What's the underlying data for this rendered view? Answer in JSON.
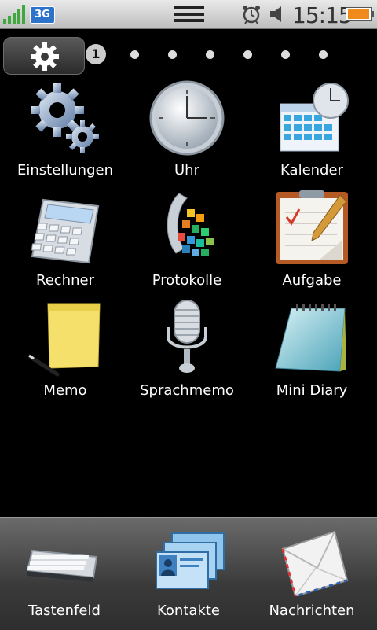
{
  "status_bar": {
    "network_type": "3G",
    "time": "15:15",
    "icons": [
      "signal-icon",
      "network-3g-icon",
      "drag-handle-icon",
      "alarm-icon",
      "volume-icon",
      "battery-icon"
    ]
  },
  "page_indicator": {
    "current": "1",
    "total_dots": 7
  },
  "apps": [
    {
      "label": "Einstellungen",
      "icon": "settings-gears-icon"
    },
    {
      "label": "Uhr",
      "icon": "clock-icon"
    },
    {
      "label": "Kalender",
      "icon": "calendar-icon"
    },
    {
      "label": "Rechner",
      "icon": "calculator-icon"
    },
    {
      "label": "Protokolle",
      "icon": "logs-icon"
    },
    {
      "label": "Aufgabe",
      "icon": "tasks-clipboard-icon"
    },
    {
      "label": "Memo",
      "icon": "sticky-note-icon"
    },
    {
      "label": "Sprachmemo",
      "icon": "microphone-icon"
    },
    {
      "label": "Mini Diary",
      "icon": "notepad-icon"
    }
  ],
  "dock": [
    {
      "label": "Tastenfeld",
      "icon": "keypad-icon"
    },
    {
      "label": "Kontakte",
      "icon": "contacts-icon"
    },
    {
      "label": "Nachrichten",
      "icon": "envelope-icon"
    }
  ],
  "colors": {
    "background": "#000000",
    "status_bar": "#d0d0d0",
    "dock": "#4a4a4a",
    "battery_fill": "#f08a1c",
    "network_badge": "#2d73c9"
  }
}
